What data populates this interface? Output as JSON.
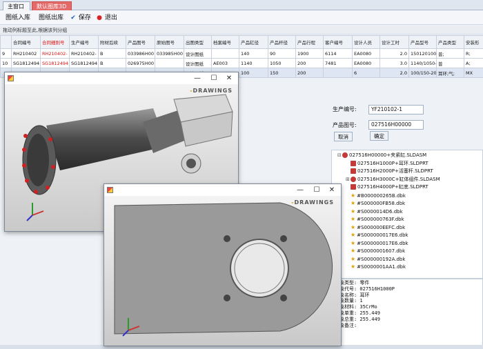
{
  "tabs": [
    "主窗口",
    "默认图库3D"
  ],
  "toolbar": {
    "import": "图纸入库",
    "export": "图纸出库",
    "save": "保存",
    "exit": "退出"
  },
  "group_hint": "拖动列标题至此,根据该列分组",
  "table": {
    "headers": [
      "",
      "合同编号",
      "合同细则号",
      "生产编号",
      "附材后续",
      "产品图号",
      "原始图号",
      "出图类型",
      "档案编号",
      "产品缸径",
      "产品杆径",
      "产品行程",
      "客户编号",
      "设计人员",
      "设计工时",
      "产品型号",
      "产品类型",
      "安装形"
    ],
    "rows": [
      [
        "9",
        "RH210402",
        "RH210402-",
        "RH210402-",
        "B",
        "033986H00",
        "033985H00",
        "设计图纸",
        "",
        "140",
        "90",
        "1900",
        "6114",
        "EA0080",
        "2.0",
        "150120100",
        "普;",
        "R;"
      ],
      [
        "10",
        "SG1812494",
        "SG1812494",
        "SG1812494",
        "B",
        "026975H00",
        "",
        "设计图纸",
        "AE003",
        "1140",
        "1050",
        "200",
        "7481",
        "EA0080",
        "3.0",
        "1140/1050-",
        "普",
        "A;"
      ],
      [
        "",
        "",
        "",
        "",
        "",
        "",
        "",
        "设计图纸",
        "",
        "100",
        "150",
        "200",
        "",
        "6",
        "2.0",
        "100/150-20",
        "耳环;气;",
        "MX"
      ]
    ]
  },
  "form": {
    "prod_no_label": "生产编号:",
    "prod_no_value": "YF210102-1",
    "drawing_no_label": "产品图号:",
    "drawing_no_value": "027516H00000",
    "cancel": "取消",
    "ok": "确定"
  },
  "tree": [
    {
      "label": "027516H00000+夹紧缸.SLDASM",
      "kind": "asm",
      "level": 0,
      "exp": "⊟"
    },
    {
      "label": "027516H1000P+耳环.SLDPRT",
      "kind": "part",
      "level": 1,
      "exp": ""
    },
    {
      "label": "027516H2000P+活塞杆.SLDPRT",
      "kind": "part",
      "level": 1,
      "exp": ""
    },
    {
      "label": "027516H3000C+缸体组件.SLDASM",
      "kind": "asm",
      "level": 1,
      "exp": "⊞"
    },
    {
      "label": "027516H4000P+缸底.SLDPRT",
      "kind": "part",
      "level": 1,
      "exp": ""
    },
    {
      "label": "#B000000265B.dbk",
      "kind": "std",
      "level": 1,
      "exp": ""
    },
    {
      "label": "#S000000FB58.dbk",
      "kind": "std",
      "level": 1,
      "exp": ""
    },
    {
      "label": "#S0000014D6.dbk",
      "kind": "std",
      "level": 1,
      "exp": ""
    },
    {
      "label": "#S000000763F.dbk",
      "kind": "std",
      "level": 1,
      "exp": ""
    },
    {
      "label": "#S000000EEFC.dbk",
      "kind": "std",
      "level": 1,
      "exp": ""
    },
    {
      "label": "#S000000017E6.dbk",
      "kind": "std",
      "level": 1,
      "exp": ""
    },
    {
      "label": "#S000000017E6.dbk",
      "kind": "std",
      "level": 1,
      "exp": ""
    },
    {
      "label": "#S0000001607.dbk",
      "kind": "std",
      "level": 1,
      "exp": ""
    },
    {
      "label": "#S000000192A.dbk",
      "kind": "std",
      "level": 1,
      "exp": ""
    },
    {
      "label": "#S0000001AA1.dbk",
      "kind": "std",
      "level": 1,
      "exp": ""
    }
  ],
  "props": [
    "对象类型: 零件",
    "对象代号: 027516H1000P",
    "对象名称: 耳环",
    "对象数量: 1",
    "对象材料: 35CrMo",
    "对象单重: 255.449",
    "对象总重: 255.449",
    "对象备注:"
  ],
  "window": {
    "brand_prefix": "-",
    "brand": "DRAWINGS",
    "minimize": "—",
    "maximize": "☐",
    "close": "✕"
  },
  "colors": {
    "accent_tab": "#e46a6a",
    "red_text": "#dd1111",
    "selection": "#dde6f2"
  }
}
